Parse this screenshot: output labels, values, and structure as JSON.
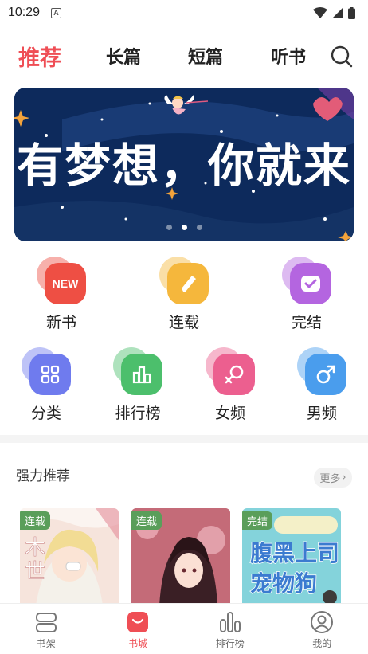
{
  "status": {
    "time": "10:29",
    "notif_icon": "A"
  },
  "tabs": [
    {
      "label": "推荐",
      "active": true
    },
    {
      "label": "长篇",
      "active": false
    },
    {
      "label": "短篇",
      "active": false
    },
    {
      "label": "听书",
      "active": false
    }
  ],
  "banner": {
    "text": "有梦想，你就来",
    "dots": 3,
    "active_dot": 2
  },
  "categories": [
    {
      "label": "新书",
      "icon": "new-icon",
      "color": "#ee4f44"
    },
    {
      "label": "连载",
      "icon": "pencil-icon",
      "color": "#f5b73c"
    },
    {
      "label": "完结",
      "icon": "check-icon",
      "color": "#b465e0"
    },
    {
      "label": "分类",
      "icon": "grid-icon",
      "color": "#6f7bee"
    },
    {
      "label": "排行榜",
      "icon": "bar-chart-icon",
      "color": "#4cbf6c"
    },
    {
      "label": "女频",
      "icon": "female-icon",
      "color": "#ec5f8f"
    },
    {
      "label": "男频",
      "icon": "male-icon",
      "color": "#4a9ded"
    }
  ],
  "section": {
    "title": "强力推荐",
    "more": "更多"
  },
  "books": [
    {
      "tag": "连载",
      "cover_color": "#f3d9d2"
    },
    {
      "tag": "连载",
      "cover_color": "#c96a78"
    },
    {
      "tag": "完结",
      "cover_color": "#7fd0d8"
    }
  ],
  "nav": [
    {
      "label": "书架",
      "icon": "bookshelf-icon",
      "active": false
    },
    {
      "label": "书城",
      "icon": "bookstore-icon",
      "active": true
    },
    {
      "label": "排行榜",
      "icon": "ranking-icon",
      "active": false
    },
    {
      "label": "我的",
      "icon": "profile-icon",
      "active": false
    }
  ],
  "colors": {
    "accent": "#ef4e55",
    "banner_bg": "#0d2a5c",
    "tag_green": "#5a9e5a"
  }
}
